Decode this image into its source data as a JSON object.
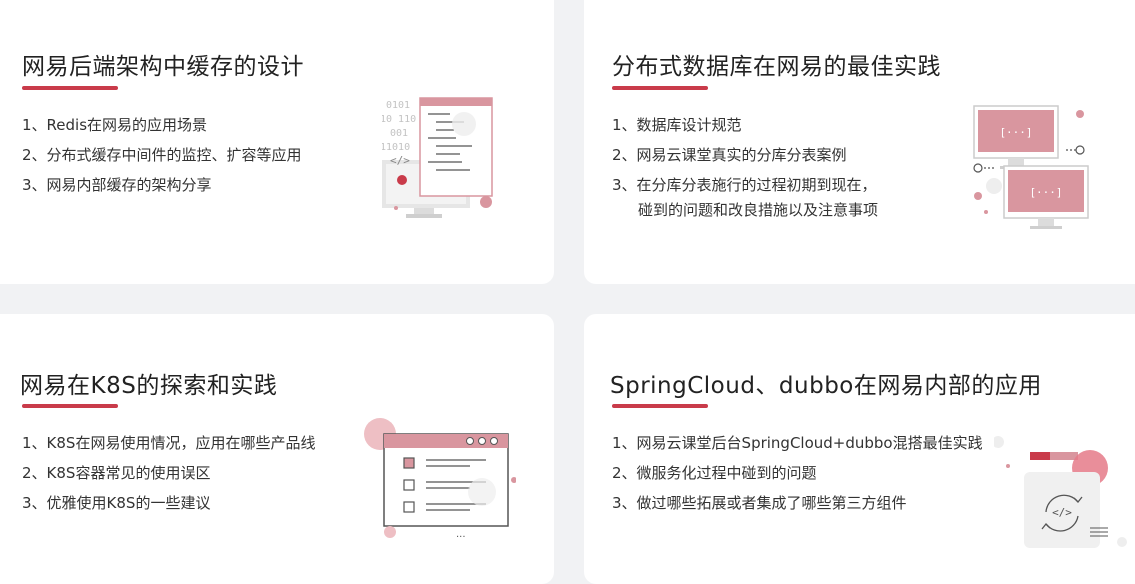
{
  "cards": [
    {
      "title": "网易后端架构中缓存的设计",
      "items": [
        "1、Redis在网易的应用场景",
        "2、分布式缓存中间件的监控、扩容等应用",
        "3、网易内部缓存的架构分享"
      ],
      "illustration": "code-monitor-icon"
    },
    {
      "title": "分布式数据库在网易的最佳实践",
      "items": [
        "1、数据库设计规范",
        "2、网易云课堂真实的分库分表案例",
        "3、在分库分表施行的过程初期到现在，",
        "碰到的问题和改良措施以及注意事项"
      ],
      "illustration": "distributed-monitors-icon"
    },
    {
      "title": "网易在K8S的探索和实践",
      "items": [
        "1、K8S在网易使用情况，应用在哪些产品线",
        "2、K8S容器常见的使用误区",
        "3、优雅使用K8S的一些建议"
      ],
      "illustration": "checklist-window-icon"
    },
    {
      "title": "SpringCloud、dubbo在网易内部的应用",
      "items": [
        "1、网易云课堂后台SpringCloud+dubbo混搭最佳实践",
        "2、微服务化过程中碰到的问题",
        "3、做过哪些拓展或者集成了哪些第三方组件"
      ],
      "illustration": "code-sync-icon"
    }
  ],
  "illustration_text": {
    "binary_lines": [
      "0101",
      "10 110",
      "001",
      "11010"
    ],
    "code_tag": "</>",
    "bracket_dots": "[···]",
    "ellipsis": "···"
  },
  "colors": {
    "accent": "#c93b4a",
    "pink": "#d9969f",
    "light_pink": "#eebfc4",
    "gray": "#d6d6d6",
    "text": "#333333",
    "background": "#f1f2f4"
  }
}
